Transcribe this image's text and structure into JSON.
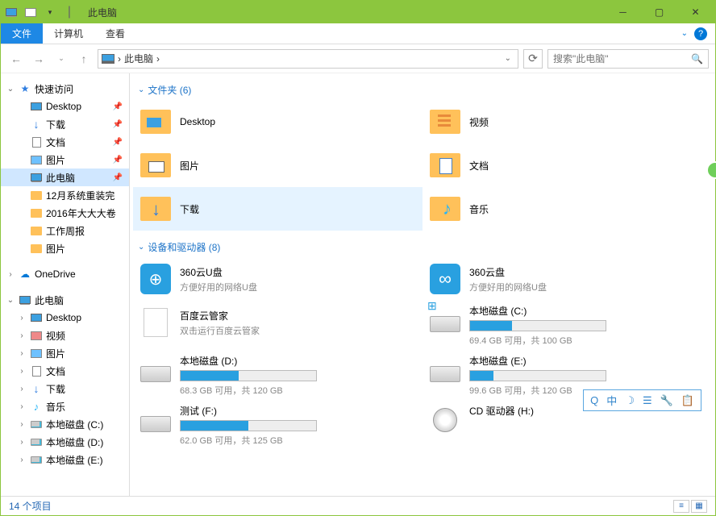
{
  "title": "此电脑",
  "menu": {
    "file": "文件",
    "computer": "计算机",
    "view": "查看"
  },
  "breadcrumb": {
    "path": "此电脑",
    "sep": "›"
  },
  "search": {
    "placeholder": "搜索\"此电脑\""
  },
  "sidebar": {
    "quick": {
      "label": "快速访问",
      "items": [
        {
          "label": "Desktop",
          "icon": "desktop"
        },
        {
          "label": "下载",
          "icon": "dl"
        },
        {
          "label": "文档",
          "icon": "doc"
        },
        {
          "label": "图片",
          "icon": "pic"
        },
        {
          "label": "此电脑",
          "icon": "pc",
          "selected": true
        },
        {
          "label": "12月系统重装完",
          "icon": "folder"
        },
        {
          "label": "2016年大大大卷",
          "icon": "folder"
        },
        {
          "label": "工作周报",
          "icon": "folder"
        },
        {
          "label": "图片",
          "icon": "folder"
        }
      ]
    },
    "onedrive": "OneDrive",
    "thispc": {
      "label": "此电脑",
      "items": [
        {
          "label": "Desktop",
          "icon": "desktop"
        },
        {
          "label": "视频",
          "icon": "video"
        },
        {
          "label": "图片",
          "icon": "pic"
        },
        {
          "label": "文档",
          "icon": "doc"
        },
        {
          "label": "下载",
          "icon": "dl"
        },
        {
          "label": "音乐",
          "icon": "music"
        },
        {
          "label": "本地磁盘 (C:)",
          "icon": "drive"
        },
        {
          "label": "本地磁盘 (D:)",
          "icon": "drive"
        },
        {
          "label": "本地磁盘 (E:)",
          "icon": "drive"
        }
      ]
    }
  },
  "sections": {
    "folders": {
      "header": "文件夹 (6)",
      "items": [
        {
          "label": "Desktop",
          "cls": "blue"
        },
        {
          "label": "视频",
          "cls": "video"
        },
        {
          "label": "图片",
          "cls": "pic"
        },
        {
          "label": "文档",
          "cls": "doc"
        },
        {
          "label": "下载",
          "cls": "dl",
          "hl": true
        },
        {
          "label": "音乐",
          "cls": "music"
        }
      ]
    },
    "devices": {
      "header": "设备和驱动器 (8)",
      "items": [
        {
          "label": "360云U盘",
          "sub": "方便好用的网络U盘",
          "type": "usb"
        },
        {
          "label": "360云盘",
          "sub": "方便好用的网络U盘",
          "type": "cloud"
        },
        {
          "label": "百度云管家",
          "sub": "双击运行百度云管家",
          "type": "file"
        },
        {
          "label": "本地磁盘 (C:)",
          "free": "69.4 GB 可用，共 100 GB",
          "fill": 31,
          "type": "drive",
          "win": true
        },
        {
          "label": "本地磁盘 (D:)",
          "free": "68.3 GB 可用，共 120 GB",
          "fill": 43,
          "type": "drive"
        },
        {
          "label": "本地磁盘 (E:)",
          "free": "99.6 GB 可用，共 120 GB",
          "fill": 17,
          "type": "drive"
        },
        {
          "label": "测试 (F:)",
          "free": "62.0 GB 可用，共 125 GB",
          "fill": 50,
          "type": "drive"
        },
        {
          "label": "CD 驱动器 (H:)",
          "type": "cd"
        }
      ]
    }
  },
  "status": "14 个项目",
  "float": [
    "Q",
    "中",
    "☽",
    "☰",
    "🔧",
    "📋"
  ]
}
